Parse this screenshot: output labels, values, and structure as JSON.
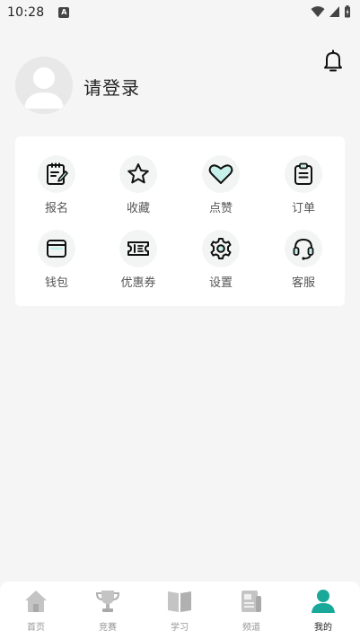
{
  "status_bar": {
    "time": "10:28",
    "badge": "A"
  },
  "profile": {
    "login_prompt": "请登录"
  },
  "menu": {
    "items": [
      {
        "label": "报名",
        "icon": "register-icon"
      },
      {
        "label": "收藏",
        "icon": "star-icon"
      },
      {
        "label": "点赞",
        "icon": "heart-icon"
      },
      {
        "label": "订单",
        "icon": "clipboard-icon"
      },
      {
        "label": "钱包",
        "icon": "wallet-icon"
      },
      {
        "label": "优惠券",
        "icon": "coupon-icon"
      },
      {
        "label": "设置",
        "icon": "gear-icon"
      },
      {
        "label": "客服",
        "icon": "headset-icon"
      }
    ]
  },
  "bottom_nav": {
    "items": [
      {
        "label": "首页",
        "icon": "home-icon"
      },
      {
        "label": "竞赛",
        "icon": "trophy-icon"
      },
      {
        "label": "学习",
        "icon": "book-icon"
      },
      {
        "label": "频道",
        "icon": "news-icon"
      },
      {
        "label": "我的",
        "icon": "user-icon",
        "active": true
      }
    ]
  },
  "colors": {
    "accent": "#1aa89a",
    "icon_outline": "#111111",
    "accent_fill": "#c8f0ea"
  }
}
